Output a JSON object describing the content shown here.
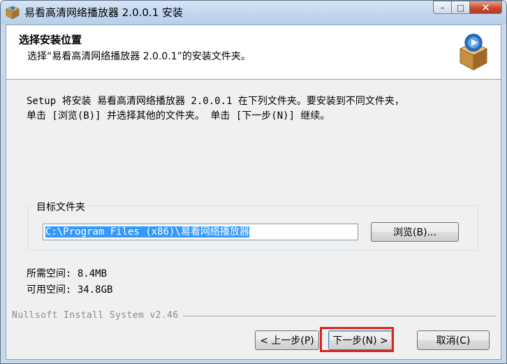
{
  "window": {
    "title": "易看高清网络播放器 2.0.0.1 安装",
    "caption": {
      "minimize": "–",
      "maximize": "□",
      "close": "✕"
    }
  },
  "header": {
    "title": "选择安装位置",
    "subtitle": "选择“易看高清网络播放器 2.0.0.1”的安装文件夹。"
  },
  "description": {
    "line1": "Setup 将安装 易看高清网络播放器 2.0.0.1 在下列文件夹。要安装到不同文件夹，",
    "line2": "单击 [浏览(B)] 并选择其他的文件夹。 单击 [下一步(N)] 继续。"
  },
  "destination": {
    "group_label": "目标文件夹",
    "path_value": "C:\\Program Files (x86)\\易看网络播放器",
    "browse_label": "浏览(B)..."
  },
  "space": {
    "required": "所需空间: 8.4MB",
    "available": "可用空间: 34.8GB"
  },
  "branding": "Nullsoft Install System v2.46",
  "buttons": {
    "back": "< 上一步(P)",
    "next": "下一步(N) >",
    "cancel": "取消(C)"
  },
  "colors": {
    "highlight": "#e0231a",
    "selection": "#3399ff"
  }
}
